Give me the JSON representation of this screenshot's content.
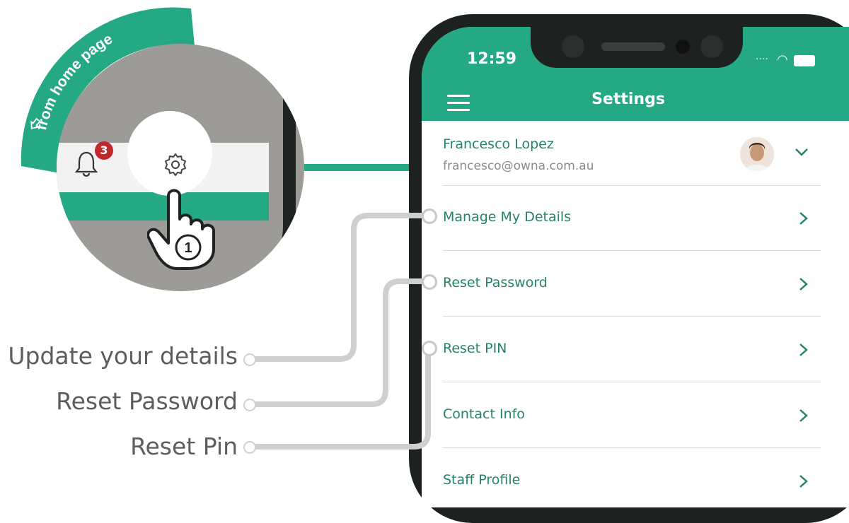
{
  "banner": {
    "text": "from home page",
    "icon": "arrow-left-icon"
  },
  "zoom": {
    "badge_count": "3",
    "step_number": "1"
  },
  "phone": {
    "status": {
      "time": "12:59"
    },
    "header": {
      "title": "Settings"
    },
    "account": {
      "name": "Francesco Lopez",
      "email": "francesco@owna.com.au"
    },
    "menu_items": [
      {
        "label": "Manage My Details"
      },
      {
        "label": "Reset Password"
      },
      {
        "label": "Reset PIN"
      },
      {
        "label": "Contact Info"
      },
      {
        "label": "Staff Profile"
      }
    ]
  },
  "callouts": [
    {
      "label": "Update your details"
    },
    {
      "label": "Reset Password"
    },
    {
      "label": "Reset Pin"
    }
  ],
  "colors": {
    "accent": "#25a884",
    "text_accent": "#23846a",
    "badge": "#c0282d",
    "frame": "#1d2120"
  }
}
